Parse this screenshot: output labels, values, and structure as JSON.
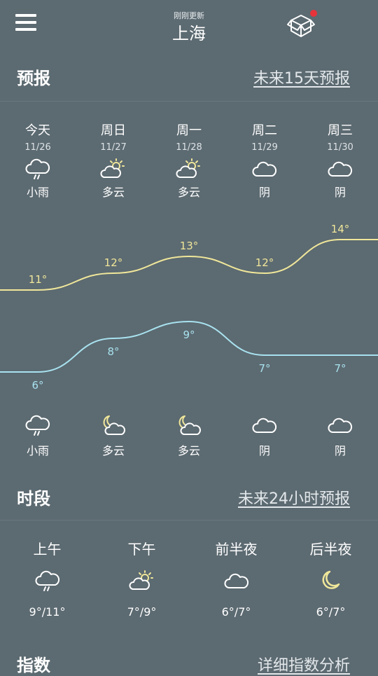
{
  "header": {
    "updated": "刚刚更新",
    "city": "上海"
  },
  "forecast": {
    "title": "预报",
    "link": "未来15天预报",
    "days": [
      {
        "name": "今天",
        "date": "11/26",
        "day_cond": "小雨",
        "night_cond": "小雨",
        "high": "11°",
        "low": "6°",
        "day_icon": "light-rain-icon",
        "night_icon": "light-rain-icon"
      },
      {
        "name": "周日",
        "date": "11/27",
        "day_cond": "多云",
        "night_cond": "多云",
        "high": "12°",
        "low": "8°",
        "day_icon": "partly-cloudy-day-icon",
        "night_icon": "partly-cloudy-night-icon"
      },
      {
        "name": "周一",
        "date": "11/28",
        "day_cond": "多云",
        "night_cond": "多云",
        "high": "13°",
        "low": "9°",
        "day_icon": "partly-cloudy-day-icon",
        "night_icon": "partly-cloudy-night-icon"
      },
      {
        "name": "周二",
        "date": "11/29",
        "day_cond": "阴",
        "night_cond": "阴",
        "high": "12°",
        "low": "7°",
        "day_icon": "cloud-icon",
        "night_icon": "cloud-icon"
      },
      {
        "name": "周三",
        "date": "11/30",
        "day_cond": "阴",
        "night_cond": "阴",
        "high": "14°",
        "low": "7°",
        "day_icon": "cloud-icon",
        "night_icon": "cloud-icon"
      }
    ],
    "high_values": [
      11,
      12,
      13,
      12,
      14
    ],
    "low_values": [
      6,
      8,
      9,
      7,
      7
    ]
  },
  "periods": {
    "title": "时段",
    "link": "未来24小时预报",
    "items": [
      {
        "name": "上午",
        "temp": "9°/11°",
        "icon": "light-rain-icon"
      },
      {
        "name": "下午",
        "temp": "7°/9°",
        "icon": "partly-cloudy-day-icon"
      },
      {
        "name": "前半夜",
        "temp": "6°/7°",
        "icon": "cloud-icon"
      },
      {
        "name": "后半夜",
        "temp": "6°/7°",
        "icon": "moon-icon"
      }
    ]
  },
  "index": {
    "title": "指数",
    "link": "详细指数分析"
  },
  "colors": {
    "background": "#5c6a71",
    "high_line": "#f0e79a",
    "low_line": "#a8e2ef",
    "badge": "#e8333b"
  }
}
